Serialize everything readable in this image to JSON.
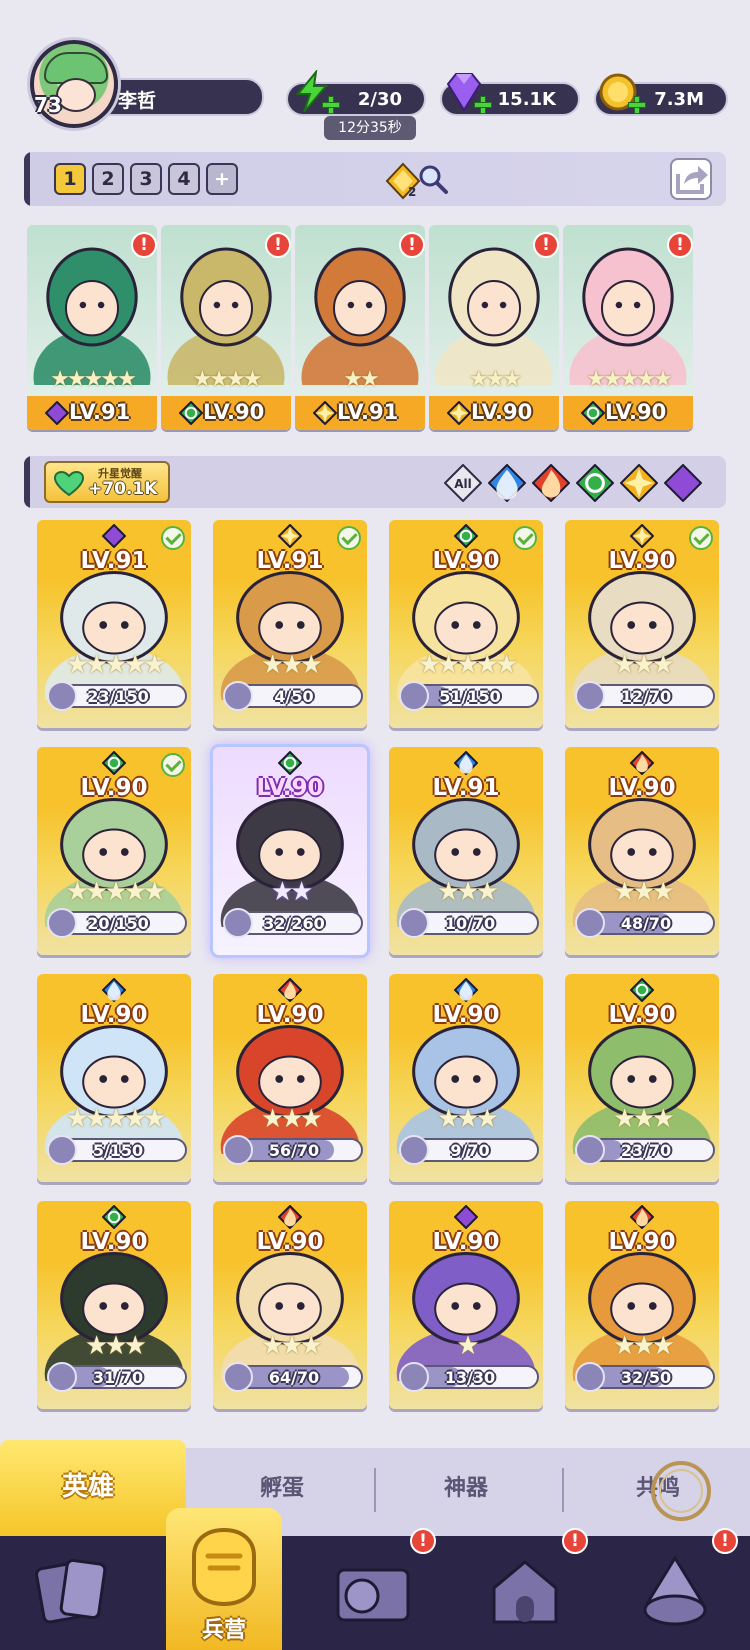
{
  "player": {
    "level": "73",
    "name": "李哲"
  },
  "resources": {
    "energy": {
      "value": "2/30",
      "timer": "12分35秒"
    },
    "gems": {
      "value": "15.1K"
    },
    "gold": {
      "value": "7.3M"
    }
  },
  "teams": {
    "tabs": [
      "1",
      "2",
      "3",
      "4",
      "+"
    ],
    "active": "1",
    "badge_count": "2"
  },
  "formation": [
    {
      "level": "LV.91",
      "element": "dark",
      "stars": 5,
      "alert": "!"
    },
    {
      "level": "LV.90",
      "element": "nature",
      "stars": 4,
      "alert": "!"
    },
    {
      "level": "LV.91",
      "element": "light",
      "stars": 2,
      "alert": "!"
    },
    {
      "level": "LV.90",
      "element": "light",
      "stars": 3,
      "alert": "!"
    },
    {
      "level": "LV.90",
      "element": "nature",
      "stars": 5,
      "alert": "!"
    }
  ],
  "upgrade": {
    "label": "升星觉醒",
    "amount": "+70.1K"
  },
  "filters": [
    "All",
    "water",
    "fire",
    "nature",
    "light",
    "dark"
  ],
  "colors": {
    "water": "#2f86e6",
    "fire": "#e4412b",
    "nature": "#34b04a",
    "light": "#f2b21f",
    "dark": "#8f4ad6"
  },
  "heroes": [
    {
      "level": "LV.91",
      "element": "dark",
      "stars": 5,
      "shards": "23/150",
      "fill": 0.15,
      "check": true,
      "tone": "#dfe9ea"
    },
    {
      "level": "LV.91",
      "element": "light",
      "stars": 3,
      "shards": "4/50",
      "fill": 0.08,
      "check": true,
      "tone": "#d99a4a"
    },
    {
      "level": "LV.90",
      "element": "nature",
      "stars": 5,
      "shards": "51/150",
      "fill": 0.34,
      "check": true,
      "tone": "#f7e3a0"
    },
    {
      "level": "LV.90",
      "element": "light",
      "stars": 3,
      "shards": "12/70",
      "fill": 0.17,
      "check": true,
      "tone": "#e8dcc2"
    },
    {
      "level": "LV.90",
      "element": "nature",
      "stars": 5,
      "shards": "20/150",
      "fill": 0.13,
      "check": true,
      "tone": "#a9cf9a"
    },
    {
      "level": "LV.90",
      "element": "nature",
      "stars": 2,
      "shards": "32/260",
      "fill": 0.12,
      "check": false,
      "selected": true,
      "tone": "#3d3a45"
    },
    {
      "level": "LV.91",
      "element": "water",
      "stars": 3,
      "shards": "10/70",
      "fill": 0.14,
      "check": false,
      "tone": "#a9bac6"
    },
    {
      "level": "LV.90",
      "element": "fire",
      "stars": 3,
      "shards": "48/70",
      "fill": 0.69,
      "check": false,
      "tone": "#e6bd84"
    },
    {
      "level": "LV.90",
      "element": "water",
      "stars": 5,
      "shards": "5/150",
      "fill": 0.03,
      "check": false,
      "tone": "#cfe4f7"
    },
    {
      "level": "LV.90",
      "element": "fire",
      "stars": 3,
      "shards": "56/70",
      "fill": 0.8,
      "check": false,
      "tone": "#d9452a"
    },
    {
      "level": "LV.90",
      "element": "water",
      "stars": 3,
      "shards": "9/70",
      "fill": 0.13,
      "check": false,
      "tone": "#a8c3e5"
    },
    {
      "level": "LV.90",
      "element": "nature",
      "stars": 3,
      "shards": "23/70",
      "fill": 0.33,
      "check": false,
      "tone": "#8ebd6b"
    },
    {
      "level": "LV.90",
      "element": "nature",
      "stars": 3,
      "shards": "31/70",
      "fill": 0.44,
      "check": false,
      "tone": "#2d3a2e"
    },
    {
      "level": "LV.90",
      "element": "fire",
      "stars": 3,
      "shards": "64/70",
      "fill": 0.91,
      "check": false,
      "tone": "#f2ddb0"
    },
    {
      "level": "LV.90",
      "element": "dark",
      "stars": 1,
      "shards": "13/30",
      "fill": 0.43,
      "check": false,
      "tone": "#7f5ec7"
    },
    {
      "level": "LV.90",
      "element": "fire",
      "stars": 3,
      "shards": "32/50",
      "fill": 0.64,
      "check": false,
      "tone": "#e79a3c"
    }
  ],
  "subtabs": [
    "英雄",
    "孵蛋",
    "神器",
    "共鸣"
  ],
  "nav": {
    "center_label": "兵营",
    "alerts": [
      "!",
      "!",
      "!"
    ]
  }
}
